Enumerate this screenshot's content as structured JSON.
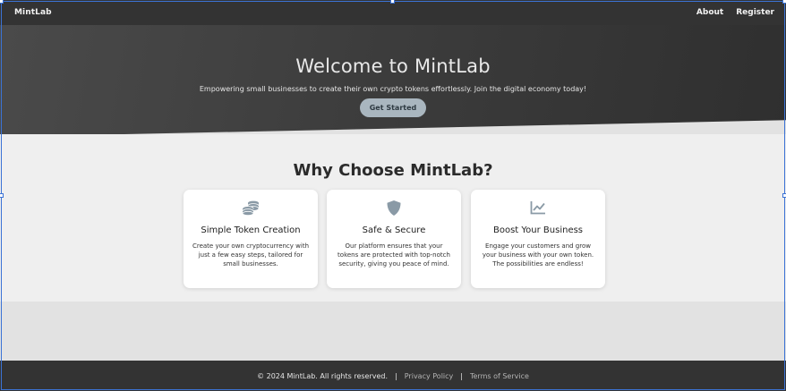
{
  "nav": {
    "brand": "MintLab",
    "links": [
      "About",
      "Register"
    ]
  },
  "hero": {
    "title": "Welcome to MintLab",
    "subtitle": "Empowering small businesses to create their own crypto tokens effortlessly. Join the digital economy today!",
    "cta": "Get Started"
  },
  "features": {
    "title": "Why Choose MintLab?",
    "cards": [
      {
        "icon": "coins-icon",
        "title": "Simple Token Creation",
        "text": "Create your own cryptocurrency with just a few easy steps, tailored for small businesses."
      },
      {
        "icon": "shield-icon",
        "title": "Safe & Secure",
        "text": "Our platform ensures that your tokens are protected with top-notch security, giving you peace of mind."
      },
      {
        "icon": "chart-line-icon",
        "title": "Boost Your Business",
        "text": "Engage your customers and grow your business with your own token. The possibilities are endless!"
      }
    ]
  },
  "footer": {
    "copyright": "© 2024 MintLab. All rights reserved.",
    "separator": "|",
    "links": [
      "Privacy Policy",
      "Terms of Service"
    ]
  },
  "colors": {
    "nav_bg": "#333333",
    "button_bg": "#a9b6bf",
    "icon": "#8a9aa6"
  }
}
